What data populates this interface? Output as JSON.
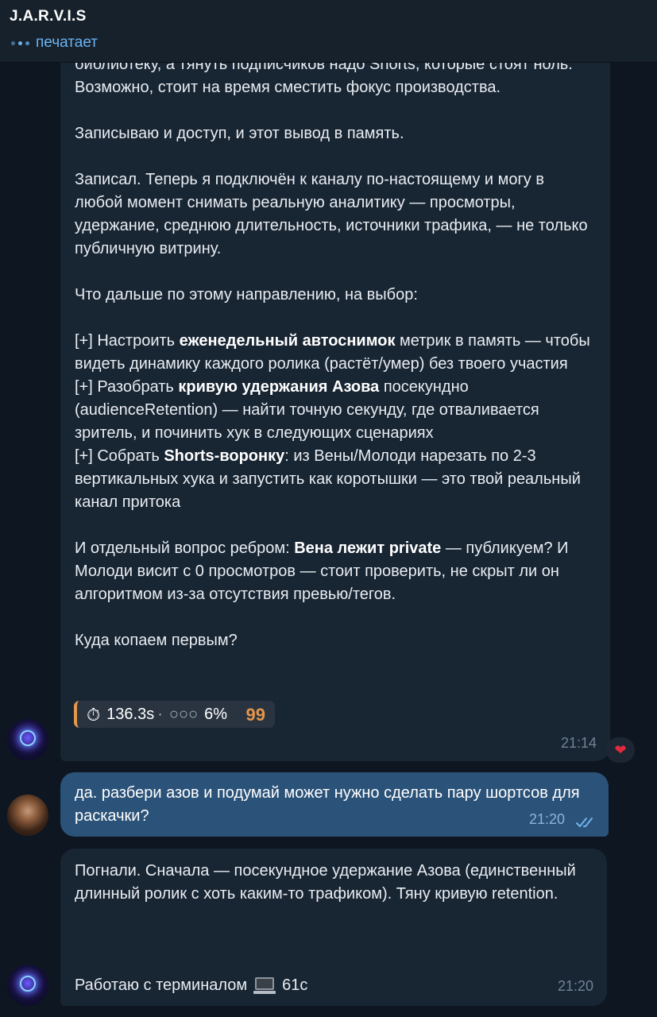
{
  "header": {
    "title": "J.A.R.V.I.S",
    "status": "печатает"
  },
  "messages": {
    "m1": {
      "p1": "библиотеку, а тянуть подписчиков надо Shorts, которые стоят ноль. Возможно, стоит на время сместить фокус производства.",
      "p2": "Записываю и доступ, и этот вывод в память.",
      "p3": "Записал. Теперь я подключён к каналу по-настоящему и могу в любой момент снимать реальную аналитику — просмотры, удержание, среднюю длительность, источники трафика, — не только публичную витрину.",
      "p4": "Что дальше по этому направлению, на выбор:",
      "opt1_pre": "[+] Настроить ",
      "opt1_bold": "еженедельный автоснимок",
      "opt1_post": " метрик в память — чтобы видеть динамику каждого ролика (растёт/умер) без твоего участия",
      "opt2_pre": "[+] Разобрать ",
      "opt2_bold": "кривую удержания Азова",
      "opt2_post": " посекундно (audienceRetention) — найти точную секунду, где отваливается зритель, и починить хук в следующих сценариях",
      "opt3_pre": "[+] Собрать ",
      "opt3_bold": "Shorts-воронку",
      "opt3_post": ": из Вены/Молоди нарезать по 2-3 вертикальных хука и запустить как коротышки — это твой реальный канал притока",
      "q_pre": "И отдельный вопрос ребром: ",
      "q_bold": "Вена лежит private",
      "q_post": " — публикуем? И Молоди висит с 0 просмотров — стоит проверить, не скрыт ли он алгоритмом из-за отсутствия превью/тегов.",
      "p_last": "Куда копаем первым?",
      "meta": {
        "duration": "136.3s",
        "separator": "·",
        "dots": "○○○",
        "percent": "6%",
        "quote": "99"
      },
      "time": "21:14",
      "reaction": "❤"
    },
    "m2": {
      "text": "да. разбери азов и подумай может нужно сделать пару шортсов для раскачки?",
      "time": "21:20"
    },
    "m3": {
      "text": "Погнали. Сначала — посекундное удержание Азова (единственный длинный ролик с хоть каким-то трафиком). Тяну кривую retention.",
      "work_label": "Работаю с терминалом",
      "work_time": "61с",
      "time": "21:20"
    }
  },
  "icons": {
    "stopwatch": "⏱",
    "terminal": "terminal-icon",
    "read_receipt": "double-check-icon",
    "typing": "typing-dots-icon"
  },
  "colors": {
    "background": "#0e1621",
    "incoming": "#182533",
    "outgoing": "#2b5278",
    "accent": "#6ab3f3",
    "quote_bar": "#e3974a"
  }
}
